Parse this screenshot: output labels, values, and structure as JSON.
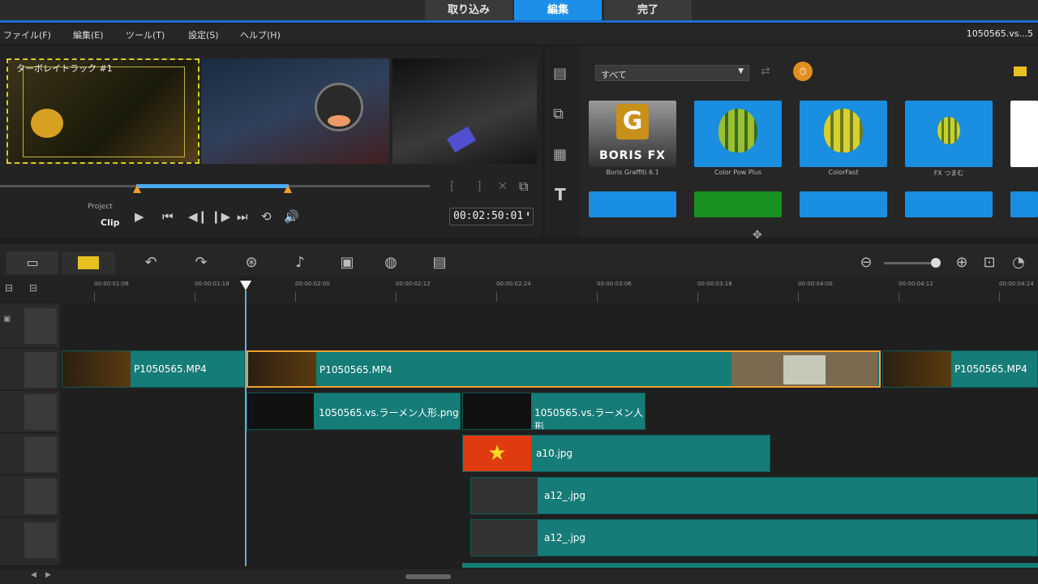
{
  "steps": [
    {
      "label": "取り込み",
      "active": false
    },
    {
      "label": "編集",
      "active": true
    },
    {
      "label": "完了",
      "active": false
    }
  ],
  "menu": [
    "ファイル(F)",
    "編集(E)",
    "ツール(T)",
    "設定(S)",
    "ヘルプ(H)"
  ],
  "project_file": "1050565.vs...5",
  "preview": {
    "overlay_title": "ターボレイトラック #1",
    "mode_project": "Project",
    "mode_clip": "Clip",
    "timecode": "00:02:50:01"
  },
  "library": {
    "filter": "すべて",
    "items": [
      {
        "name": "Boris Graffiti 6.1",
        "logo": "BORIS FX"
      },
      {
        "name": "Color Pow Plus"
      },
      {
        "name": "ColorFast"
      },
      {
        "name": "FX つまむ"
      }
    ]
  },
  "ruler": [
    "00:00:01:06",
    "00:00:01:18",
    "00:00:02:00",
    "00:00:02:12",
    "00:00:02:24",
    "00:00:03:06",
    "00:00:03:18",
    "00:00:04:00",
    "00:00:04:12",
    "00:00:04:24"
  ],
  "clips": {
    "video1_a": "P1050565.MP4",
    "video1_b": "P1050565.MP4",
    "video1_c": "P1050565.MP4",
    "overlay1_a": "1050565.vs.ラーメン人形.png",
    "overlay1_b": "1050565.vs.ラーメン人形",
    "overlay2": "a10.jpg",
    "overlay3": "a12_.jpg",
    "overlay4": "a12_.jpg"
  },
  "colors": {
    "accent": "#1e8fe8",
    "clip": "#167c78",
    "selected": "#f0a030"
  }
}
